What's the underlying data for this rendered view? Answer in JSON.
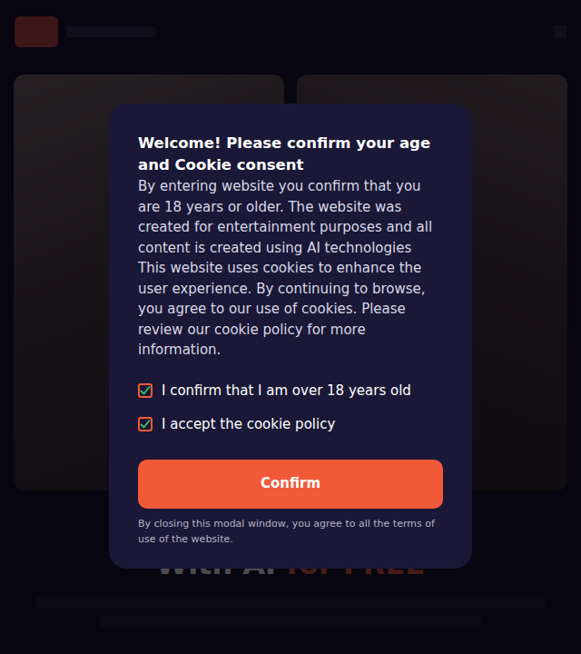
{
  "modal": {
    "title": "Welcome! Please confirm your age and Cookie consent",
    "body": "By entering website you confirm that you are 18 years or older. The website was created for entertainment purposes and all content is created using AI technologies This website uses cookies to enhance the user experience. By continuing to browse, you agree to our use of cookies. Please review our cookie policy for more information.",
    "checkboxes": [
      {
        "label": "I confirm that I am over 18 years old",
        "checked": true
      },
      {
        "label": "I accept the cookie policy",
        "checked": true
      }
    ],
    "button": "Confirm",
    "note": "By closing this modal window, you agree to all the terms of use of the website."
  },
  "hero": {
    "heading": "With AI",
    "highlight": "for FREE"
  }
}
